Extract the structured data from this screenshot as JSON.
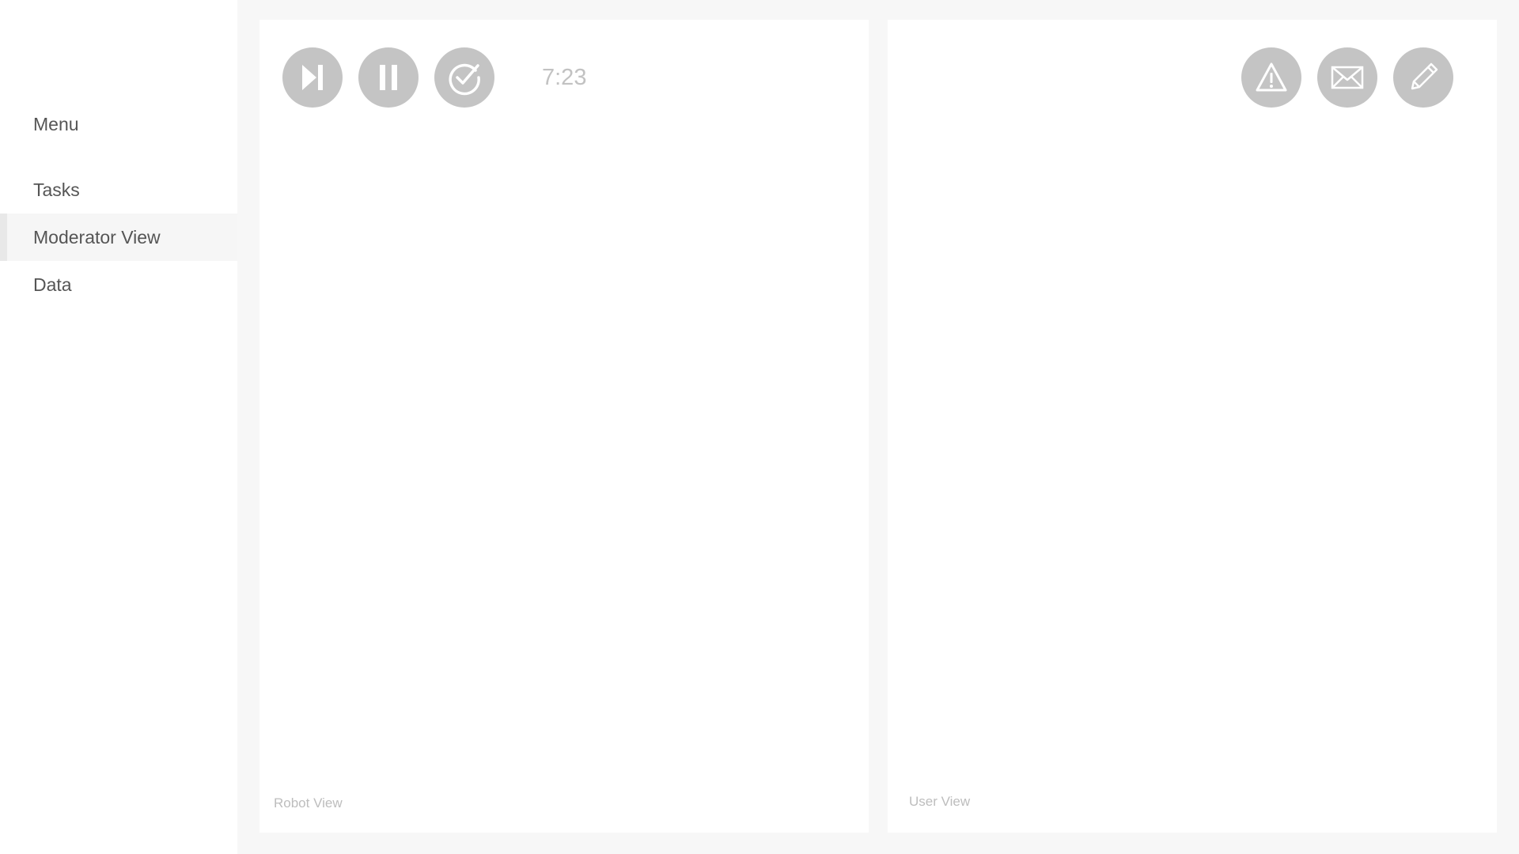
{
  "sidebar": {
    "title": "Menu",
    "items": [
      {
        "label": "Tasks",
        "active": false
      },
      {
        "label": "Moderator View",
        "active": true
      },
      {
        "label": "Data",
        "active": false
      }
    ]
  },
  "robot_panel": {
    "controls": [
      {
        "icon": "skip-next-icon"
      },
      {
        "icon": "pause-icon"
      },
      {
        "icon": "check-circle-icon"
      }
    ],
    "timer": "7:23",
    "caption": "Robot View"
  },
  "user_panel": {
    "actions": [
      {
        "icon": "warning-icon"
      },
      {
        "icon": "mail-icon"
      },
      {
        "icon": "pencil-icon"
      }
    ],
    "caption": "User View"
  },
  "colors": {
    "background": "#f7f7f7",
    "panel": "#ffffff",
    "button": "#c4c4c4",
    "text": "#555555",
    "muted_text": "#bdbdbd"
  }
}
